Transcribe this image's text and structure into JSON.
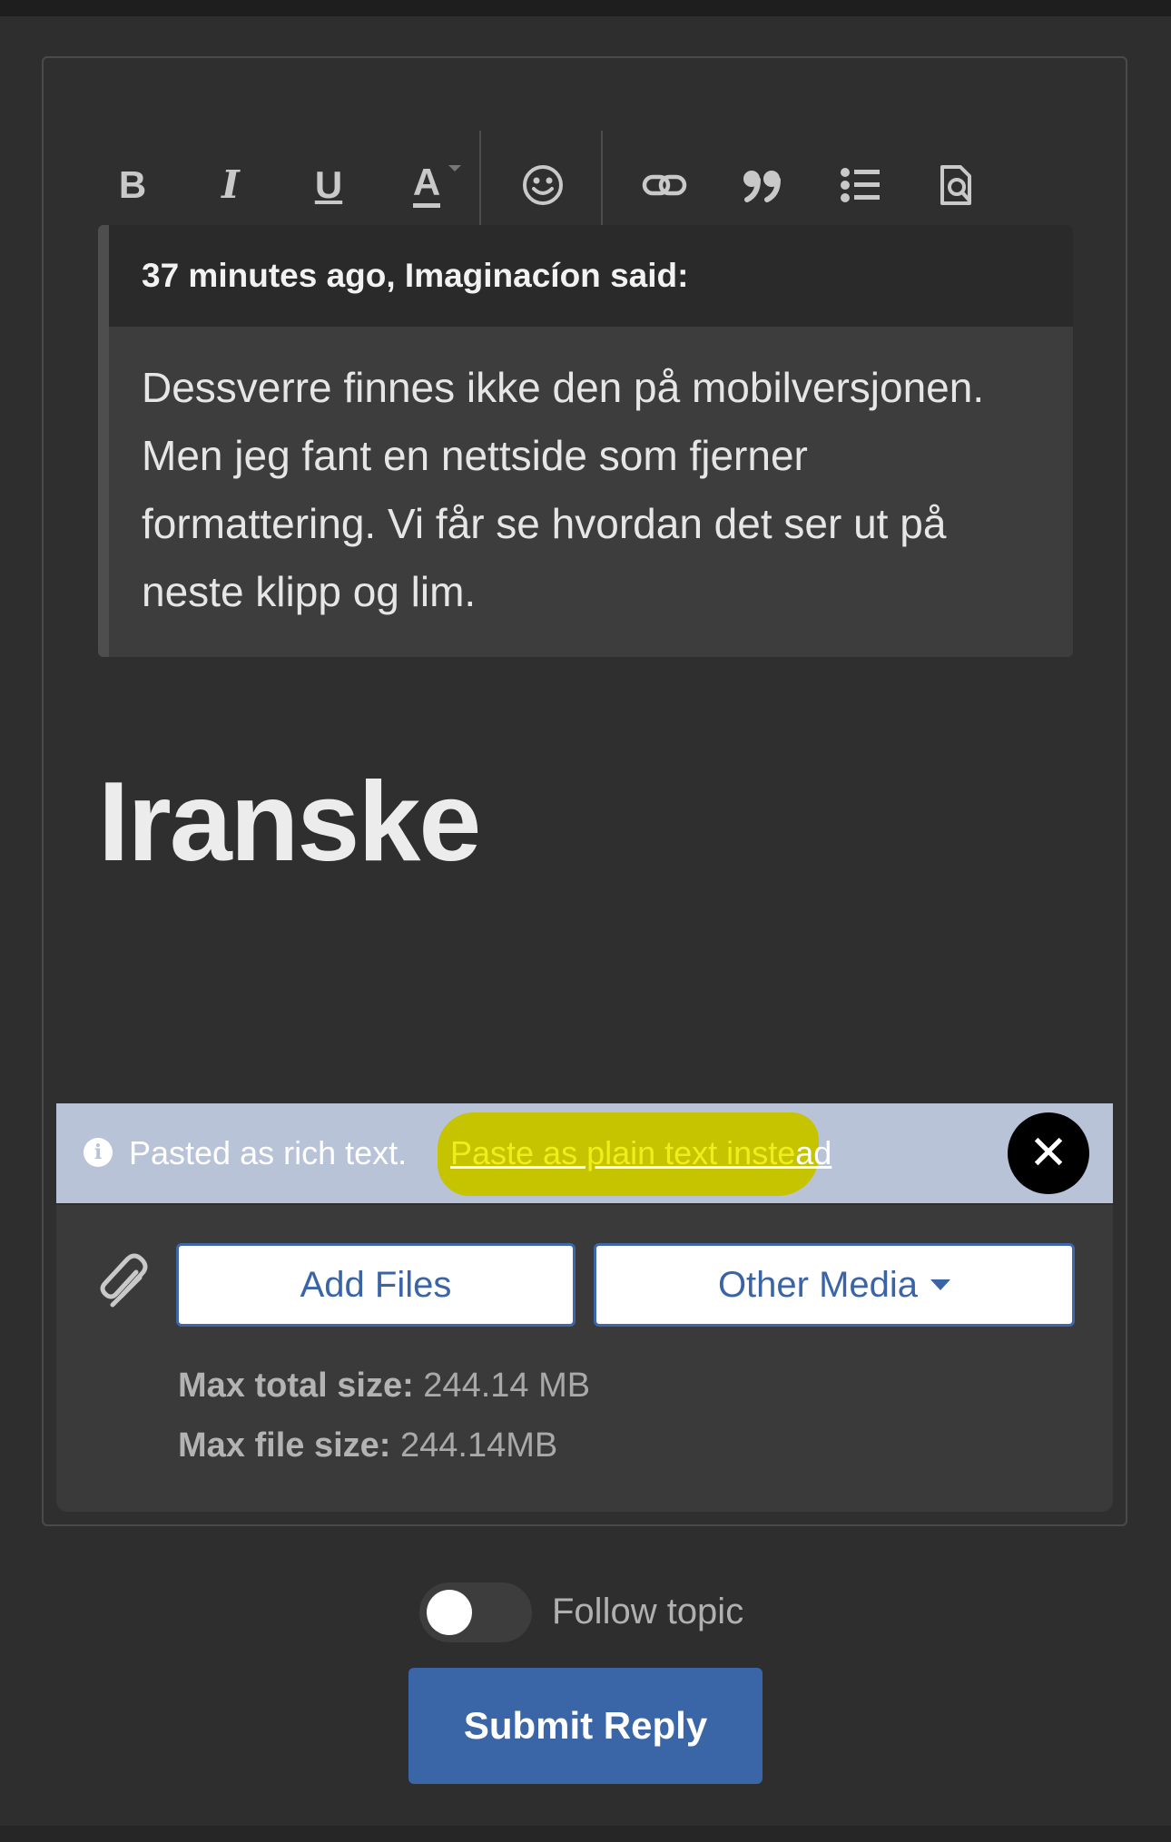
{
  "toolbar": {
    "bold_label": "B",
    "italic_label": "I",
    "underline_label": "U",
    "text_color_label": "A"
  },
  "quote": {
    "citation": "37 minutes ago, Imaginacíon said:",
    "body": "Dessverre finnes ikke den på mobilversjonen. Men jeg fant en nettside som fjerner formattering. Vi får se hvordan det ser ut på neste klipp og lim."
  },
  "editor": {
    "heading_text": "Iranske"
  },
  "paste_notice": {
    "message": "Pasted as rich text.",
    "link_highlighted": "Paste as plain text inste",
    "link_rest": "ad",
    "close_symbol": "✕"
  },
  "attachments": {
    "add_files_label": "Add Files",
    "other_media_label": "Other Media",
    "max_total_label": "Max total size:",
    "max_total_value": "244.14 MB",
    "max_file_label": "Max file size:",
    "max_file_value": "244.14MB"
  },
  "follow": {
    "label": "Follow topic",
    "enabled": false
  },
  "submit": {
    "label": "Submit Reply"
  },
  "colors": {
    "accent": "#3a65a6",
    "highlight": "#c6c300",
    "notice_bg": "#b8c3d8"
  }
}
